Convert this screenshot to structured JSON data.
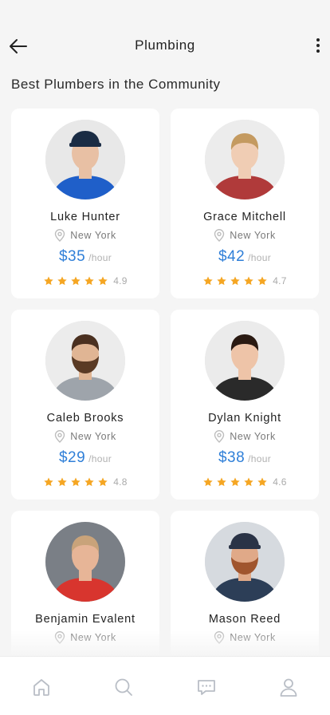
{
  "header": {
    "title": "Plumbing"
  },
  "section": {
    "title": "Best Plumbers in the Community"
  },
  "price_unit": "/hour",
  "colors": {
    "accent": "#2f7fd8",
    "star": "#f5a623",
    "background": "#f5f5f5"
  },
  "plumbers": [
    {
      "name": "Luke Hunter",
      "location": "New York",
      "price": "$35",
      "rating": "4.9",
      "shirt": "#1f5fc9",
      "bg": "#e8e8e8",
      "hair": "#3a2a20",
      "skin": "#e8c0a4",
      "cap": "#1a2c44",
      "beard": ""
    },
    {
      "name": "Grace Mitchell",
      "location": "New York",
      "price": "$42",
      "rating": "4.7",
      "shirt": "#b03a3a",
      "bg": "#ececec",
      "hair": "#c49a60",
      "skin": "#f0cdb4",
      "cap": "",
      "beard": ""
    },
    {
      "name": "Caleb Brooks",
      "location": "New York",
      "price": "$29",
      "rating": "4.8",
      "shirt": "#9ea4ab",
      "bg": "#ececec",
      "hair": "#4a3020",
      "skin": "#e0b594",
      "cap": "",
      "beard": "#5a3a24"
    },
    {
      "name": "Dylan Knight",
      "location": "New York",
      "price": "$38",
      "rating": "4.6",
      "shirt": "#2a2a2a",
      "bg": "#ebebeb",
      "hair": "#2a1a12",
      "skin": "#eec4a8",
      "cap": "",
      "beard": ""
    },
    {
      "name": "Benjamin Evalent",
      "location": "New York",
      "price": "",
      "rating": "",
      "shirt": "#d8352e",
      "bg": "#7a7f86",
      "hair": "#c9a37a",
      "skin": "#e7b597",
      "cap": "",
      "beard": ""
    },
    {
      "name": "Mason Reed",
      "location": "New York",
      "price": "",
      "rating": "",
      "shirt": "#2c3e57",
      "bg": "#d6dadf",
      "hair": "#7a4a2a",
      "skin": "#e0a988",
      "cap": "#2a3346",
      "beard": "#a0552e"
    }
  ],
  "nav": {
    "items": [
      "home-icon",
      "search-icon",
      "chat-icon",
      "profile-icon"
    ]
  }
}
